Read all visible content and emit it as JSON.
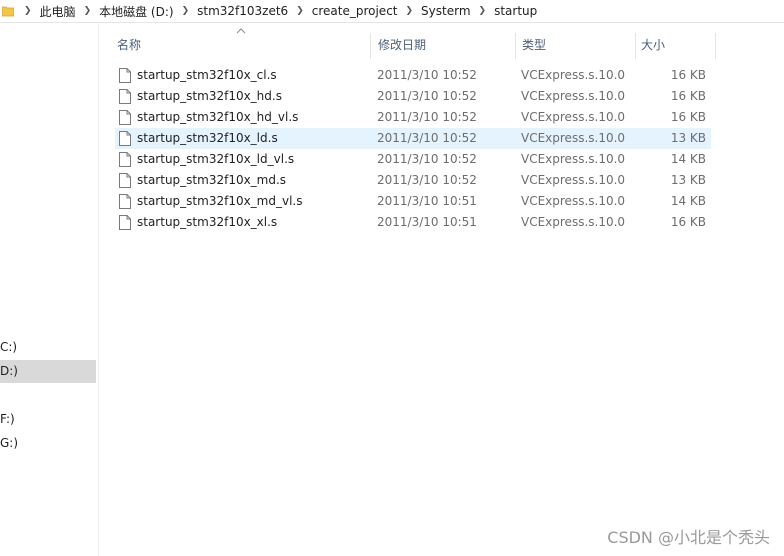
{
  "address": {
    "crumbs": [
      "此电脑",
      "本地磁盘 (D:)",
      "stm32f103zet6",
      "create_project",
      "Systerm",
      "startup"
    ]
  },
  "nav": {
    "items": [
      {
        "label": "C:)",
        "selected": false
      },
      {
        "label": "D:)",
        "selected": true
      },
      {
        "label": "F:)",
        "selected": false
      },
      {
        "label": "G:)",
        "selected": false
      }
    ]
  },
  "columns": {
    "name": "名称",
    "date": "修改日期",
    "type": "类型",
    "size": "大小"
  },
  "files": [
    {
      "name": "startup_stm32f10x_cl.s",
      "date": "2011/3/10 10:52",
      "type": "VCExpress.s.10.0",
      "size": "16 KB"
    },
    {
      "name": "startup_stm32f10x_hd.s",
      "date": "2011/3/10 10:52",
      "type": "VCExpress.s.10.0",
      "size": "16 KB"
    },
    {
      "name": "startup_stm32f10x_hd_vl.s",
      "date": "2011/3/10 10:52",
      "type": "VCExpress.s.10.0",
      "size": "16 KB"
    },
    {
      "name": "startup_stm32f10x_ld.s",
      "date": "2011/3/10 10:52",
      "type": "VCExpress.s.10.0",
      "size": "13 KB"
    },
    {
      "name": "startup_stm32f10x_ld_vl.s",
      "date": "2011/3/10 10:52",
      "type": "VCExpress.s.10.0",
      "size": "14 KB"
    },
    {
      "name": "startup_stm32f10x_md.s",
      "date": "2011/3/10 10:52",
      "type": "VCExpress.s.10.0",
      "size": "13 KB"
    },
    {
      "name": "startup_stm32f10x_md_vl.s",
      "date": "2011/3/10 10:51",
      "type": "VCExpress.s.10.0",
      "size": "14 KB"
    },
    {
      "name": "startup_stm32f10x_xl.s",
      "date": "2011/3/10 10:51",
      "type": "VCExpress.s.10.0",
      "size": "16 KB"
    }
  ],
  "selected_file_index": 3,
  "watermark": "CSDN @小北是个秃头"
}
